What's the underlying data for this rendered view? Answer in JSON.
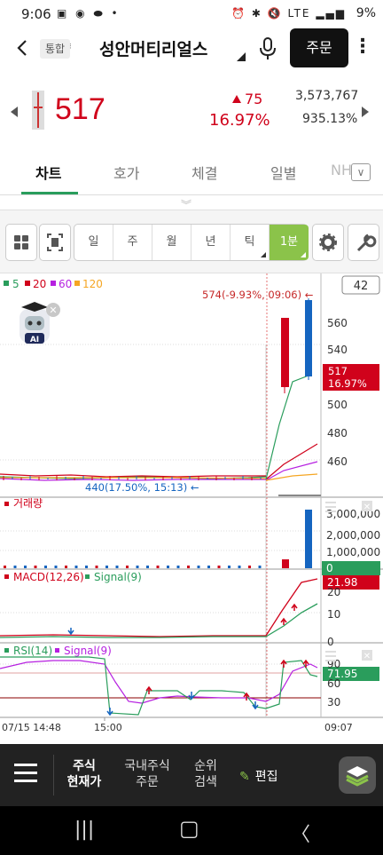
{
  "status_bar": {
    "time": "9:06",
    "battery": "9%",
    "network": "LTE"
  },
  "header": {
    "type_badge": "통합",
    "stock_name": "성안머티리얼스",
    "order_label": "주문"
  },
  "quote": {
    "price": "517",
    "change": "75",
    "change_pct": "16.97%",
    "volume": "3,573,767",
    "volume_ratio": "935.13%"
  },
  "tabs": [
    {
      "label": "차트",
      "active": true
    },
    {
      "label": "호가",
      "active": false
    },
    {
      "label": "체결",
      "active": false
    },
    {
      "label": "일별",
      "active": false
    },
    {
      "label": "NH",
      "active": false
    }
  ],
  "toolbar": {
    "periods": [
      {
        "label": "일",
        "active": false
      },
      {
        "label": "주",
        "active": false
      },
      {
        "label": "월",
        "active": false
      },
      {
        "label": "년",
        "active": false
      },
      {
        "label": "틱",
        "active": false
      },
      {
        "label": "1분",
        "active": true
      }
    ]
  },
  "chart": {
    "legend": [
      {
        "label": "5",
        "color": "#2a9d5c"
      },
      {
        "label": "20",
        "color": "#d0021b"
      },
      {
        "label": "60",
        "color": "#b620e0"
      },
      {
        "label": "120",
        "color": "#f5a623"
      }
    ],
    "count_box": "42",
    "high_annotation": "574(-9.93%, 09:06) ←",
    "low_annotation": "440(17.50%, 15:13) ←",
    "ai_badge": "AI",
    "price_axis": [
      "560",
      "540",
      "500",
      "480",
      "460"
    ],
    "current_price_label": "517",
    "current_pct_label": "16.97%",
    "volume_title": "거래량",
    "volume_axis": [
      "3,000,000",
      "2,000,000",
      "1,000,000"
    ],
    "volume_current": "0",
    "macd_title": "MACD(12,26)",
    "macd_signal": "Signal(9)",
    "macd_axis": [
      "20",
      "10",
      "0"
    ],
    "macd_current": "21.98",
    "rsi_title": "RSI(14)",
    "rsi_signal": "Signal(9)",
    "rsi_axis": [
      "90",
      "60",
      "30"
    ],
    "rsi_current": "71.95",
    "time_axis": [
      "07/15 14:48",
      "15:00",
      "09:07"
    ]
  },
  "colors": {
    "up": "#d0021b",
    "down": "#1565c0",
    "accent": "#8bc34a",
    "macd_line": "#d0021b",
    "signal_line": "#2a9d5c",
    "rsi_signal_line": "#b620e0"
  },
  "bottom_nav": {
    "items": [
      {
        "line1": "주식",
        "line2": "현재가",
        "active": true
      },
      {
        "line1": "국내주식",
        "line2": "주문",
        "active": false
      },
      {
        "line1": "순위",
        "line2": "검색",
        "active": false
      }
    ],
    "edit_label": "편집"
  }
}
